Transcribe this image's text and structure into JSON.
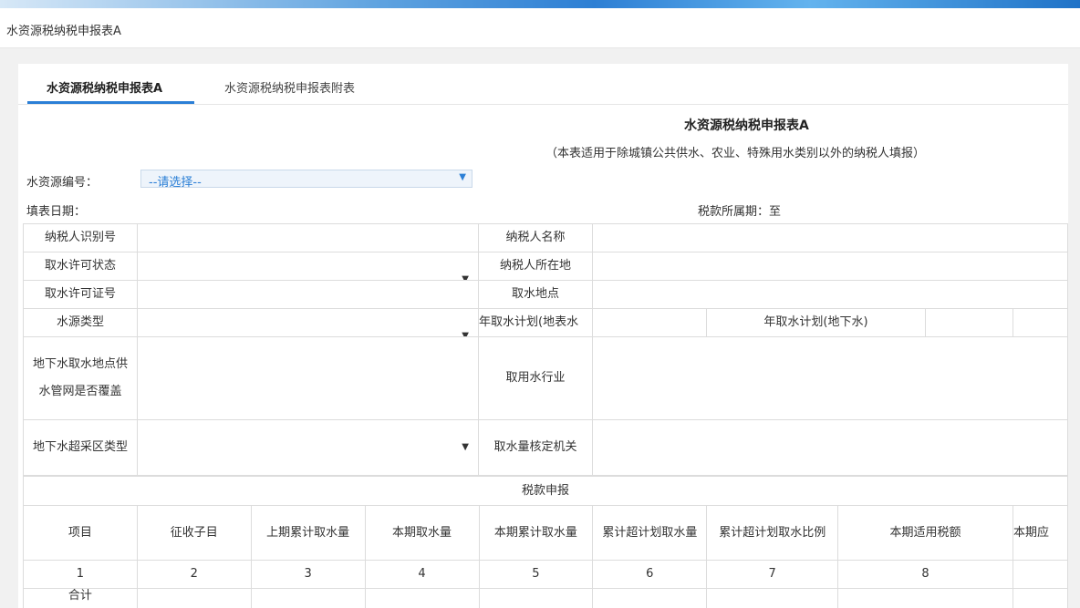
{
  "breadcrumb": "水资源税纳税申报表A",
  "tabs": [
    {
      "label": "水资源税纳税申报表A",
      "active": true
    },
    {
      "label": "水资源税纳税申报表附表",
      "active": false
    }
  ],
  "form": {
    "title": "水资源税纳税申报表A",
    "subtitle": "（本表适用于除城镇公共供水、农业、特殊用水类别以外的纳税人填报）",
    "water_resource_label": "水资源编号：",
    "water_resource_select": "--请选择--",
    "fill_date_label": "填表日期：",
    "tax_period_label": "税款所属期：至"
  },
  "info_rows": {
    "taxpayer_id": "纳税人识别号",
    "taxpayer_name": "纳税人名称",
    "permit_status": "取水许可状态",
    "taxpayer_location": "纳税人所在地",
    "permit_no": "取水许可证号",
    "intake_site": "取水地点",
    "source_type": "水源类型",
    "annual_plan_surface": "年取水计划(地表水",
    "annual_plan_ground": "年取水计划(地下水)",
    "groundwater_coverage": "地下水取水地点供水管网是否覆盖",
    "water_industry": "取用水行业",
    "overexploit_type": "地下水超采区类型",
    "verify_authority": "取水量核定机关"
  },
  "tax_section": {
    "title": "税款申报",
    "headers": [
      "项目",
      "征收子目",
      "上期累计取水量",
      "本期取水量",
      "本期累计取水量",
      "累计超计划取水量",
      "累计超计划取水比例",
      "本期适用税额",
      "本期应"
    ],
    "numbers": [
      "1",
      "2",
      "3",
      "4",
      "5",
      "6",
      "7",
      "8",
      ""
    ],
    "next_row_label": "合计"
  },
  "colors": {
    "accent": "#2b7fd6",
    "border": "#dcdcdc"
  }
}
